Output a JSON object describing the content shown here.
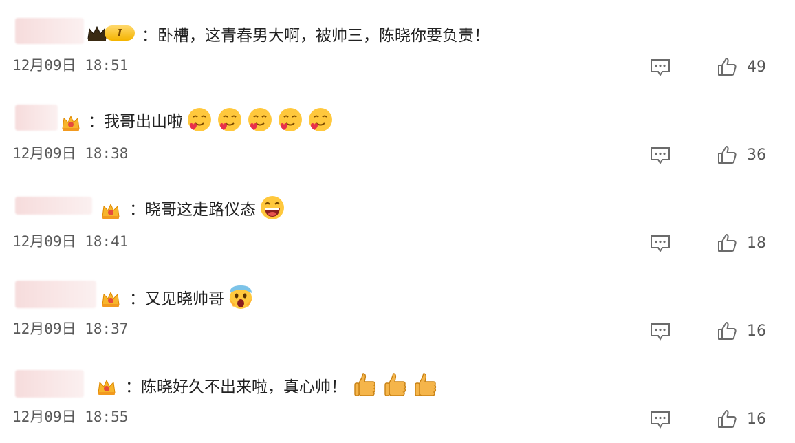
{
  "comments": [
    {
      "text": "：卧槽，这青春男大啊，被帅三，陈晓你要负责！",
      "time": "12月09日 18:51",
      "likes": "49",
      "badge": "crown-level",
      "level": "I",
      "emoji_count": 0,
      "emoji": ""
    },
    {
      "text": "：我哥出山啦",
      "time": "12月09日 18:38",
      "likes": "36",
      "badge": "vip",
      "emoji_count": 5,
      "emoji": "drooling-heart-emoji"
    },
    {
      "text": "：晓哥这走路仪态",
      "time": "12月09日 18:41",
      "likes": "18",
      "badge": "vip",
      "emoji_count": 1,
      "emoji": "laughing-emoji"
    },
    {
      "text": "：又见晓帅哥",
      "time": "12月09日 18:37",
      "likes": "16",
      "badge": "vip",
      "emoji_count": 1,
      "emoji": "screaming-emoji"
    },
    {
      "text": "：陈晓好久不出来啦，真心帅！",
      "time": "12月09日 18:55",
      "likes": "16",
      "badge": "vip",
      "emoji_count": 3,
      "emoji": "thumbs-up-emoji"
    }
  ]
}
